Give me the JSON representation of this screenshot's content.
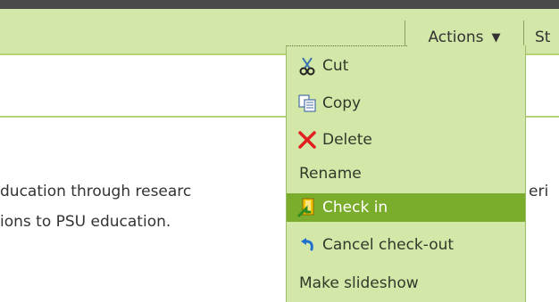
{
  "toolbar": {
    "actions_label": "Actions",
    "actions_caret": "▼",
    "next_tab_label": "St"
  },
  "content": {
    "line1": "ducation through researc",
    "line1_tail": "eri",
    "line2": "ions to PSU education."
  },
  "menu": {
    "items": [
      {
        "label": "Cut",
        "icon": "scissors-icon"
      },
      {
        "label": "Copy",
        "icon": "copy-icon"
      },
      {
        "label": "Delete",
        "icon": "delete-x-icon"
      },
      {
        "label": "Rename",
        "icon": ""
      },
      {
        "label": "Check in",
        "icon": "check-in-icon",
        "highlighted": true
      },
      {
        "label": "Cancel check-out",
        "icon": "undo-arrow-icon"
      },
      {
        "label": "Make slideshow",
        "icon": ""
      }
    ]
  },
  "colors": {
    "toolbar_bg": "#d3e7a8",
    "highlight_bg": "#7aad2b",
    "divider": "#b5d477"
  }
}
